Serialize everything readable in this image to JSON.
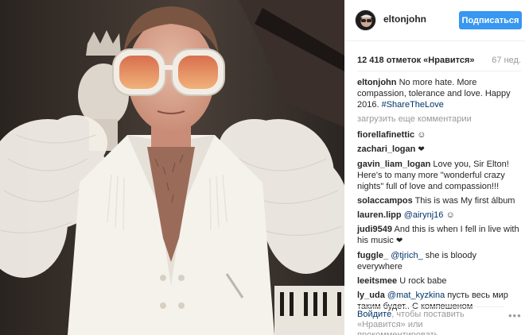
{
  "header": {
    "username": "eltonjohn",
    "follow_label": "Подписаться"
  },
  "stats": {
    "likes": "12 418 отметок «Нравится»",
    "age": "67 нед."
  },
  "caption": {
    "user": "eltonjohn",
    "text": "No more hate. More compassion, tolerance and love. Happy 2016.",
    "hashtag": "#ShareTheLove"
  },
  "load_more_label": "загрузить еще комментарии",
  "comments": [
    {
      "user": "fiorellafinettic",
      "text": "",
      "emoji": "☺"
    },
    {
      "user": "zachari_logan",
      "text": "",
      "emoji": "❤"
    },
    {
      "user": "gavin_liam_logan",
      "text": "Love you, Sir Elton! Here's to many more \"wonderful crazy nights\" full of love and compassion!!!"
    },
    {
      "user": "solaccampos",
      "text": "This is was My first álbum"
    },
    {
      "user": "lauren.lipp",
      "mention": "@airynj16",
      "emoji": "☺"
    },
    {
      "user": "judi9549",
      "text": "And this is when I fell in live with his music",
      "emoji": "❤"
    },
    {
      "user": "fuggle_",
      "mention": "@tjrich_",
      "text": "she is bloody everywhere"
    },
    {
      "user": "leeitsmee",
      "text": "U rock babe"
    },
    {
      "user": "ly_uda",
      "mention": "@mat_kyzkina",
      "text": "пусть весь мир таким будет.. С компешеном"
    }
  ],
  "login_prompt": {
    "link": "Войдите",
    "rest": ", чтобы поставить «Нравится» или прокомментировать"
  },
  "more_options_icon": "ellipsis-icon",
  "colors": {
    "accent": "#3897f0",
    "link": "#003569",
    "muted": "#999999"
  }
}
